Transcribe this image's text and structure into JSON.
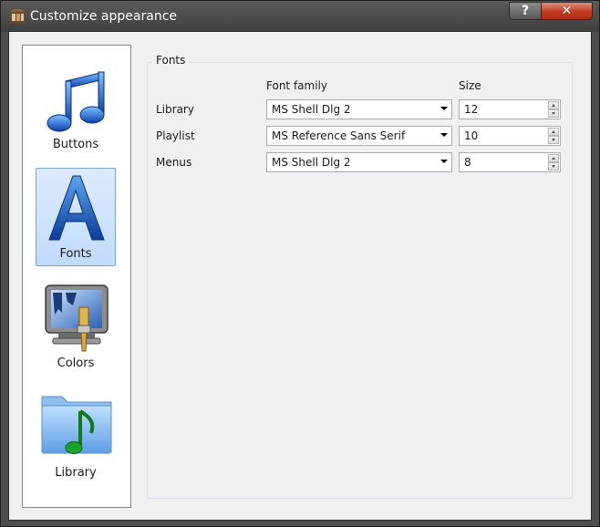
{
  "window": {
    "title": "Customize appearance",
    "help_symbol": "?",
    "close_symbol": "✕"
  },
  "sidebar": {
    "items": [
      {
        "label": "Buttons",
        "icon": "music-notes-icon",
        "selected": false
      },
      {
        "label": "Fonts",
        "icon": "letter-a-icon",
        "selected": true
      },
      {
        "label": "Colors",
        "icon": "monitor-paintbrush-icon",
        "selected": false
      },
      {
        "label": "Library",
        "icon": "music-folder-icon",
        "selected": false
      }
    ]
  },
  "fonts_group": {
    "title": "Fonts",
    "headers": {
      "family": "Font family",
      "size": "Size"
    },
    "rows": [
      {
        "label": "Library",
        "family": "MS Shell Dlg 2",
        "size": "12"
      },
      {
        "label": "Playlist",
        "family": "MS Reference Sans Serif",
        "size": "10"
      },
      {
        "label": "Menus",
        "family": "MS Shell Dlg 2",
        "size": "8"
      }
    ]
  },
  "colors": {
    "selection_bg": "#c1dbfc",
    "selection_border": "#7da2ce",
    "close_button": "#c23b20"
  }
}
